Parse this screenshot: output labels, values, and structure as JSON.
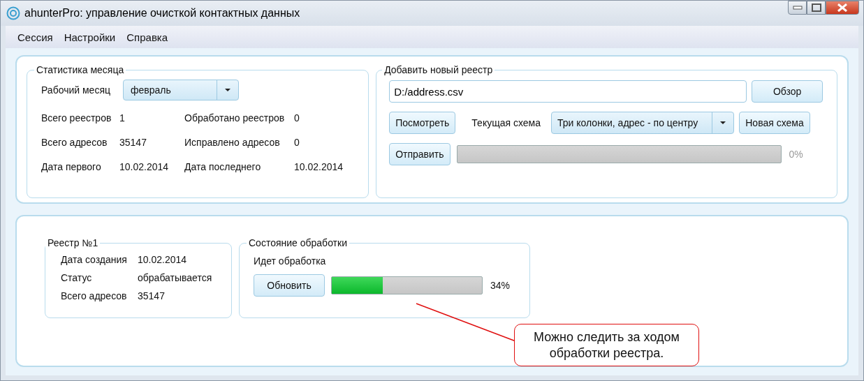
{
  "window": {
    "title": "ahunterPro: управление очисткой контактных данных"
  },
  "menu": [
    "Сессия",
    "Настройки",
    "Справка"
  ],
  "month_stats": {
    "title": "Статистика месяца",
    "month_label": "Рабочий месяц",
    "month_value": "февраль",
    "stats": [
      {
        "label": "Всего реестров",
        "value": "1"
      },
      {
        "label": "Обработано реестров",
        "value": "0"
      },
      {
        "label": "Всего адресов",
        "value": "35147"
      },
      {
        "label": "Исправлено адресов",
        "value": "0"
      },
      {
        "label": "Дата первого",
        "value": "10.02.2014"
      },
      {
        "label": "Дата последнего",
        "value": "10.02.2014"
      }
    ]
  },
  "add_registry": {
    "title": "Добавить новый реестр",
    "file_path": "D:/address.csv",
    "browse_button": "Обзор",
    "view_button": "Посмотреть",
    "scheme_label": "Текущая схема",
    "scheme_value": "Три колонки, адрес - по центру",
    "new_scheme_button": "Новая схема",
    "send_button": "Отправить",
    "progress": {
      "level": 0,
      "reading": "0%"
    }
  },
  "registry": {
    "title": "Реестр №1",
    "fields": [
      {
        "label": "Дата создания",
        "value": "10.02.2014"
      },
      {
        "label": "Статус",
        "value": "обрабатывается"
      },
      {
        "label": "Всего адресов",
        "value": "35147"
      }
    ]
  },
  "processing": {
    "title": "Состояние обработки",
    "status": "Идет обработка",
    "refresh_button": "Обновить",
    "progress": {
      "level": 0.34,
      "reading": "34%"
    }
  },
  "callout": {
    "text": "Можно следить за ходом обработки реестра."
  }
}
